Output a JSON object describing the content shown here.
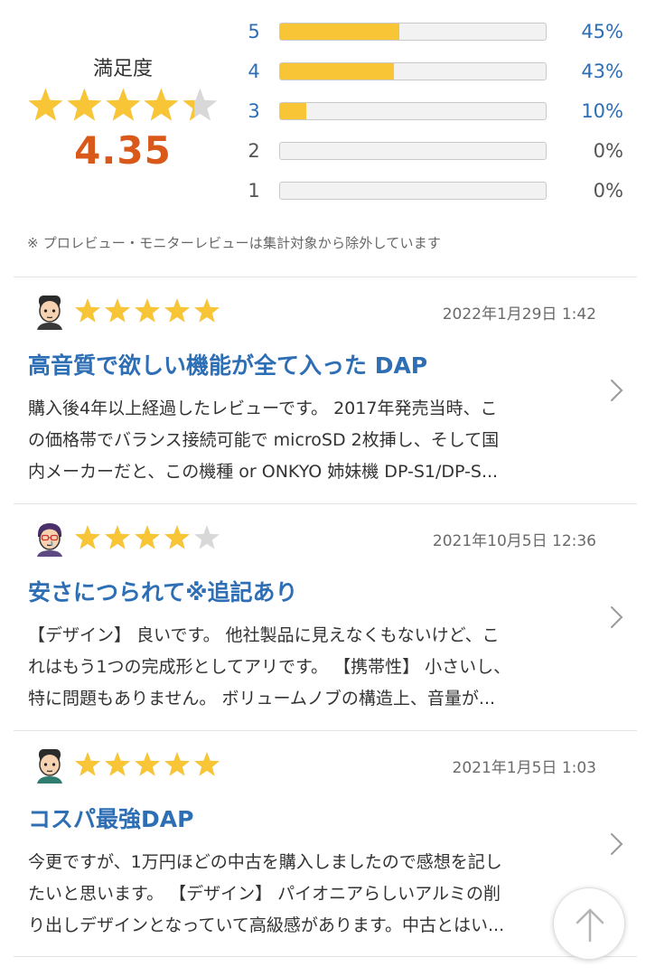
{
  "summary": {
    "satisfaction_label": "満足度",
    "average": "4.35",
    "average_value": 4.35,
    "star_color": "#f7c536",
    "empty_star_color": "#d8d8d8",
    "distribution": [
      {
        "stars": "5",
        "percent_text": "45%",
        "percent": 45
      },
      {
        "stars": "4",
        "percent_text": "43%",
        "percent": 43
      },
      {
        "stars": "3",
        "percent_text": "10%",
        "percent": 10
      },
      {
        "stars": "2",
        "percent_text": "0%",
        "percent": 0
      },
      {
        "stars": "1",
        "percent_text": "0%",
        "percent": 0
      }
    ],
    "note": "※ プロレビュー・モニターレビューは集計対象から除外しています"
  },
  "reviews": [
    {
      "rating": 5,
      "date": "2022年1月29日 1:42",
      "title": "高音質で欲しい機能が全て入った DAP",
      "body_lines": [
        "購入後4年以上経過したレビューです。 2017年発売当時、こ",
        "の価格帯でバランス接続可能で microSD 2枚挿し、そして国",
        "内メーカーだと、この機種 or ONKYO 姉妹機 DP-S1/DP-S..."
      ],
      "avatar_icon": "reviewer-avatar-icon"
    },
    {
      "rating": 4,
      "date": "2021年10月5日 12:36",
      "title": "安さにつられて※追記あり",
      "body_lines": [
        "【デザイン】 良いです。 他社製品に見えなくもないけど、こ",
        "れはもう1つの完成形としてアリです。 【携帯性】 小さいし、",
        "特に問題もありません。 ボリュームノブの構造上、音量が..."
      ],
      "avatar_icon": "reviewer-avatar-icon"
    },
    {
      "rating": 5,
      "date": "2021年1月5日 1:03",
      "title": "コスパ最強DAP",
      "body_lines": [
        "今更ですが、1万円ほどの中古を購入しましたので感想を記し",
        "たいと思います。 【デザイン】 パイオニアらしいアルミの削",
        "り出しデザインとなっていて高級感があります。中古とはい..."
      ],
      "avatar_icon": "reviewer-avatar-icon"
    }
  ],
  "scroll_top_icon": "arrow-up-icon"
}
